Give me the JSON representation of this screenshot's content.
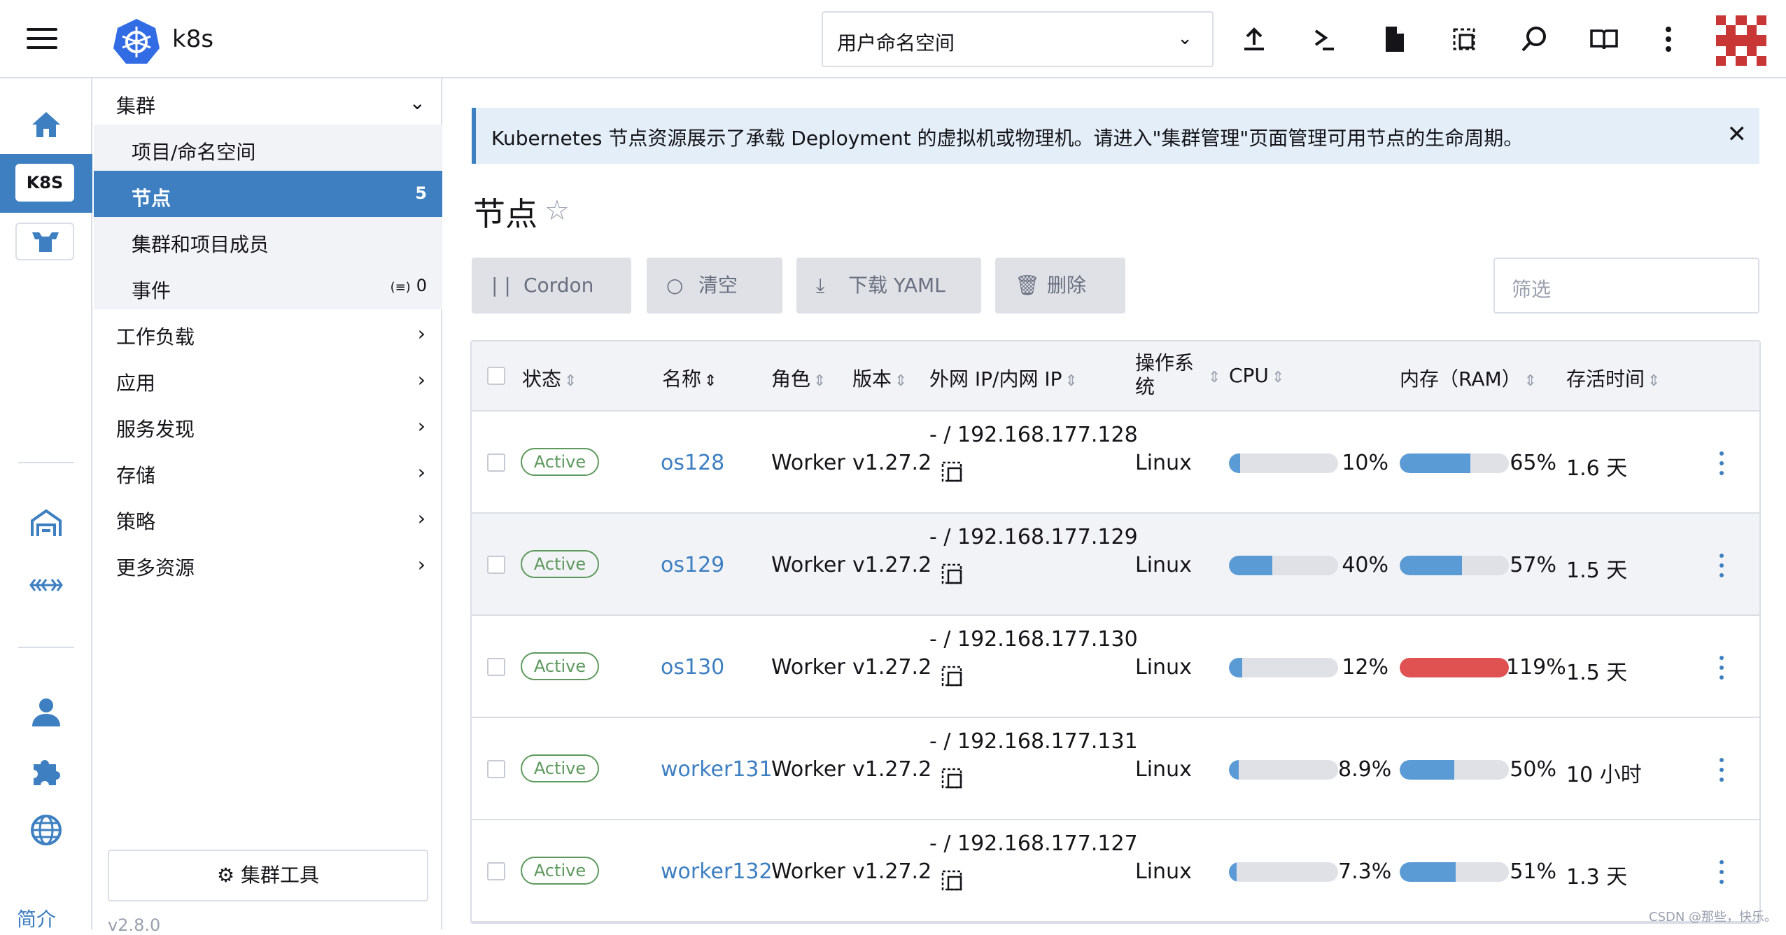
{
  "header": {
    "cluster_name": "k8s",
    "namespace_select": "用户命名空间",
    "icons": [
      "upload-icon",
      "terminal-icon",
      "file-icon",
      "copy-icon",
      "search-icon",
      "book-icon",
      "more-icon"
    ]
  },
  "rail": {
    "k8s_label": "K8S",
    "about": "简介"
  },
  "nav": {
    "cluster": "集群",
    "projects": "项目/命名空间",
    "nodes": "节点",
    "nodes_count": "5",
    "members": "集群和项目成员",
    "events": "事件",
    "events_count": "0",
    "workload": "工作负载",
    "apps": "应用",
    "service_discovery": "服务发现",
    "storage": "存储",
    "policy": "策略",
    "more_resources": "更多资源",
    "cluster_tools": "集群工具",
    "version": "v2.8.0"
  },
  "banner": {
    "text": "Kubernetes 节点资源展示了承载 Deployment 的虚拟机或物理机。请进入\"集群管理\"页面管理可用节点的生命周期。"
  },
  "page": {
    "title": "节点"
  },
  "toolbar": {
    "cordon": "Cordon",
    "drain": "清空",
    "download_yaml": "下载 YAML",
    "delete": "删除",
    "filter_placeholder": "筛选"
  },
  "table": {
    "headers": {
      "state": "状态",
      "name": "名称",
      "role": "角色",
      "version": "版本",
      "ip": "外网 IP/内网 IP",
      "os_line1": "操作系",
      "os_line2": "统",
      "cpu": "CPU",
      "ram": "内存（RAM）",
      "age": "存活时间"
    },
    "rows": [
      {
        "state": "Active",
        "name": "os128",
        "role": "Worker",
        "version": "v1.27.2",
        "ip": "- / 192.168.177.128",
        "os": "Linux",
        "cpu": "10%",
        "cpu_val": 10,
        "ram": "65%",
        "ram_val": 65,
        "age": "1.6 天"
      },
      {
        "state": "Active",
        "name": "os129",
        "role": "Worker",
        "version": "v1.27.2",
        "ip": "- / 192.168.177.129",
        "os": "Linux",
        "cpu": "40%",
        "cpu_val": 40,
        "ram": "57%",
        "ram_val": 57,
        "age": "1.5 天"
      },
      {
        "state": "Active",
        "name": "os130",
        "role": "Worker",
        "version": "v1.27.2",
        "ip": "- / 192.168.177.130",
        "os": "Linux",
        "cpu": "12%",
        "cpu_val": 12,
        "ram": "119%",
        "ram_val": 119,
        "age": "1.5 天"
      },
      {
        "state": "Active",
        "name": "worker131",
        "role": "Worker",
        "version": "v1.27.2",
        "ip": "- / 192.168.177.131",
        "os": "Linux",
        "cpu": "8.9%",
        "cpu_val": 8.9,
        "ram": "50%",
        "ram_val": 50,
        "age": "10 小时"
      },
      {
        "state": "Active",
        "name": "worker132",
        "role": "Worker",
        "version": "v1.27.2",
        "ip": "- / 192.168.177.127",
        "os": "Linux",
        "cpu": "7.3%",
        "cpu_val": 7.3,
        "ram": "51%",
        "ram_val": 51,
        "age": "1.3 天"
      }
    ]
  },
  "colors": {
    "accent": "#3d7fc1",
    "bar_normal": "#5b9bd5",
    "bar_danger": "#e05252",
    "active": "#5d995d"
  },
  "watermark": "CSDN @那些，快乐。"
}
